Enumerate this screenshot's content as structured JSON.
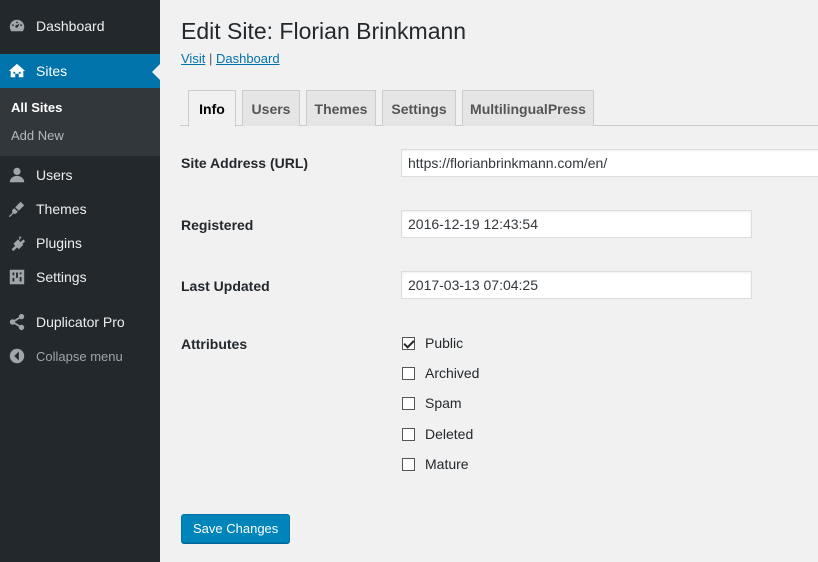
{
  "sidebar": {
    "items": [
      {
        "label": "Dashboard",
        "icon": "dashboard-icon"
      },
      {
        "label": "Sites",
        "icon": "sites-icon",
        "active": true
      },
      {
        "label": "Users",
        "icon": "users-icon"
      },
      {
        "label": "Themes",
        "icon": "themes-icon"
      },
      {
        "label": "Plugins",
        "icon": "plugins-icon"
      },
      {
        "label": "Settings",
        "icon": "settings-icon"
      },
      {
        "label": "Duplicator Pro",
        "icon": "share-icon"
      }
    ],
    "submenu": [
      {
        "label": "All Sites",
        "current": true
      },
      {
        "label": "Add New"
      }
    ],
    "collapse_label": "Collapse menu"
  },
  "header": {
    "title": "Edit Site: Florian Brinkmann",
    "visit_link": "Visit",
    "separator": "|",
    "dashboard_link": "Dashboard"
  },
  "tabs": [
    {
      "label": "Info",
      "active": true
    },
    {
      "label": "Users"
    },
    {
      "label": "Themes"
    },
    {
      "label": "Settings"
    },
    {
      "label": "MultilingualPress"
    }
  ],
  "form": {
    "site_address_label": "Site Address (URL)",
    "site_address_value": "https://florianbrinkmann.com/en/",
    "registered_label": "Registered",
    "registered_value": "2016-12-19 12:43:54",
    "last_updated_label": "Last Updated",
    "last_updated_value": "2017-03-13 07:04:25",
    "attributes_label": "Attributes",
    "attributes": [
      {
        "label": "Public",
        "checked": true
      },
      {
        "label": "Archived",
        "checked": false
      },
      {
        "label": "Spam",
        "checked": false
      },
      {
        "label": "Deleted",
        "checked": false
      },
      {
        "label": "Mature",
        "checked": false
      }
    ]
  },
  "save_button": "Save Changes",
  "colors": {
    "sidebar_bg": "#23282d",
    "accent": "#0073aa",
    "button_bg": "#0085ba"
  }
}
